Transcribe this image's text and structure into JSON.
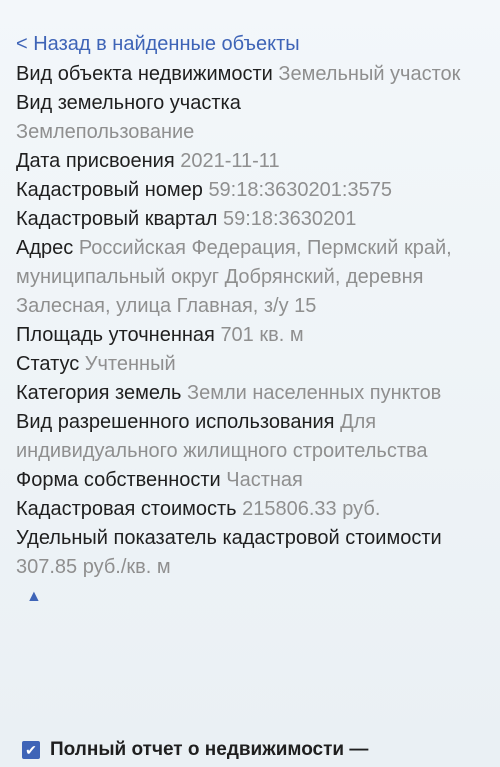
{
  "back_link": "< Назад в найденные объекты",
  "fields": [
    {
      "label": "Вид объекта недвижимости",
      "value": "Земельный участок"
    },
    {
      "label": "Вид земельного участка",
      "value": "Землепользование"
    },
    {
      "label": "Дата присвоения",
      "value": "2021-11-11"
    },
    {
      "label": "Кадастровый номер",
      "value": "59:18:3630201:3575"
    },
    {
      "label": "Кадастровый квартал",
      "value": "59:18:3630201"
    },
    {
      "label": "Адрес",
      "value": "Российская Федерация, Пермский край, муниципальный округ Добрянский, деревня Залесная, улица Главная, з/у 15"
    },
    {
      "label": "Площадь уточненная",
      "value": "701 кв. м"
    },
    {
      "label": "Статус",
      "value": "Учтенный"
    },
    {
      "label": "Категория земель",
      "value": "Земли населенных пунктов"
    },
    {
      "label": "Вид разрешенного использования",
      "value": "Для индивидуального жилищного строительства"
    },
    {
      "label": "Форма собственности",
      "value": "Частная"
    },
    {
      "label": "Кадастровая стоимость",
      "value": "215806.33 руб."
    },
    {
      "label": "Удельный показатель кадастровой стоимости",
      "value": "307.85 руб./кв. м"
    }
  ],
  "collapse_icon": "triangle-up-icon",
  "collapse_glyph": "▲",
  "footer": {
    "checkbox_glyph": "✔",
    "label": "Полный отчет о недвижимости —"
  },
  "colors": {
    "link": "#3e64b7",
    "value": "#8f8f8f",
    "text": "#1f1f1f"
  }
}
